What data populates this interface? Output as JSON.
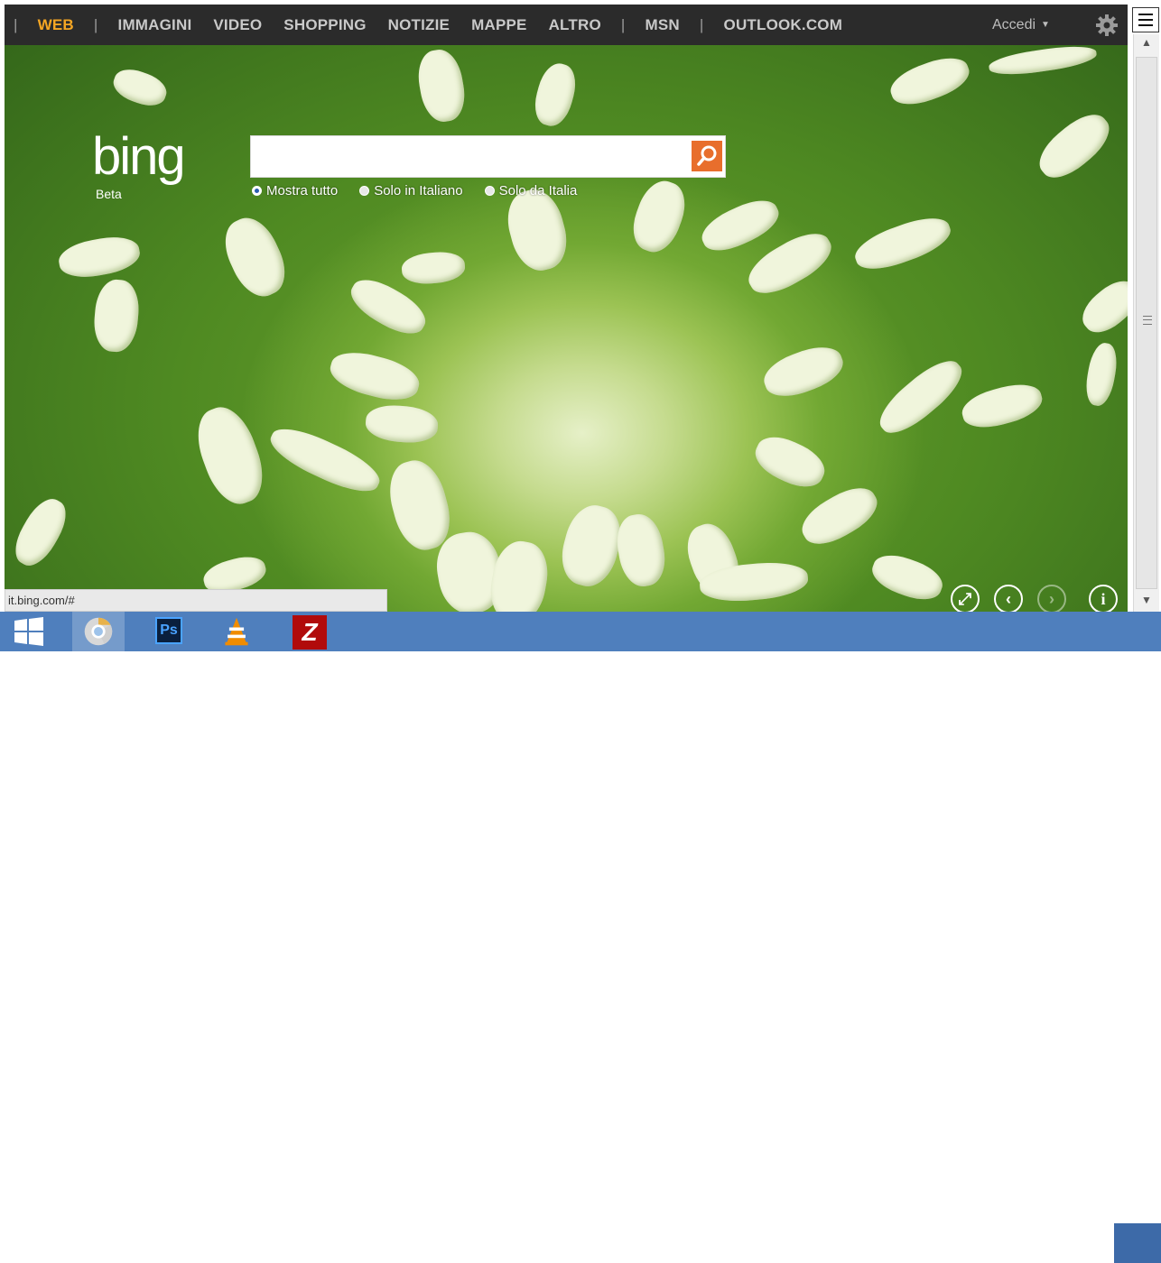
{
  "nav": {
    "items": [
      {
        "label": "WEB",
        "active": true
      },
      {
        "label": "IMMAGINI"
      },
      {
        "label": "VIDEO"
      },
      {
        "label": "SHOPPING"
      },
      {
        "label": "NOTIZIE"
      },
      {
        "label": "MAPPE"
      },
      {
        "label": "ALTRO"
      }
    ],
    "separator": "|",
    "extra": [
      "MSN",
      "OUTLOOK.COM"
    ],
    "signin": "Accedi"
  },
  "logo": {
    "text": "bing",
    "sub": "Beta"
  },
  "search": {
    "value": "",
    "options": [
      {
        "label": "Mostra tutto",
        "selected": true
      },
      {
        "label": "Solo in Italiano",
        "selected": false
      },
      {
        "label": "Solo da Italia",
        "selected": false
      }
    ]
  },
  "status_url": "it.bing.com/#",
  "taskbar": {
    "icons": [
      "windows-start-icon",
      "chrome-icon",
      "photoshop-icon",
      "vlc-icon",
      "filezilla-icon"
    ],
    "ps_label": "Ps",
    "fz_label": "Z"
  },
  "controls": [
    "fullscreen-icon",
    "previous-image-icon",
    "next-image-icon",
    "info-icon"
  ],
  "colors": {
    "accent": "#f5a623",
    "search_button": "#e86e2c",
    "taskbar": "#4f7fbd",
    "topbar": "#2b2b2b"
  }
}
